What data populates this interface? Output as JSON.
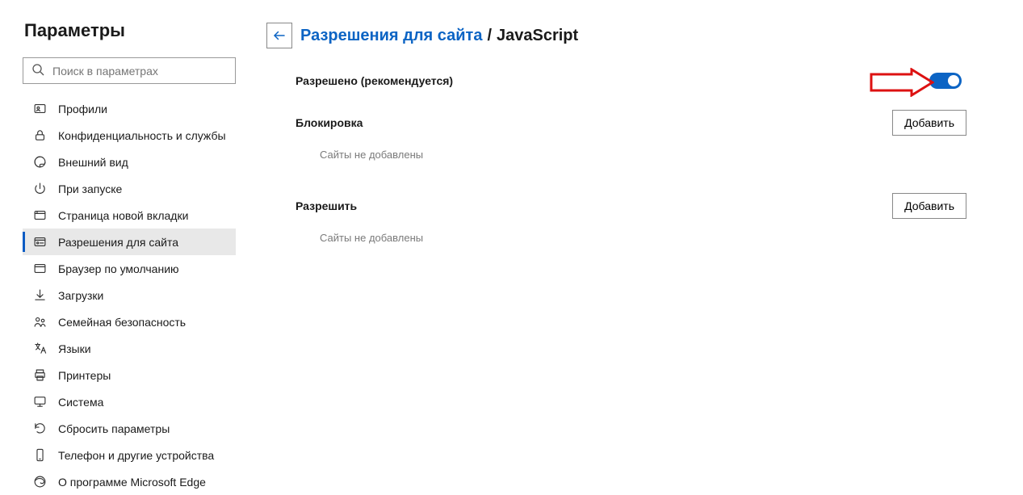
{
  "sidebar": {
    "title": "Параметры",
    "search_placeholder": "Поиск в параметрах",
    "items": [
      {
        "label": "Профили",
        "icon": "profile-card-icon"
      },
      {
        "label": "Конфиденциальность и службы",
        "icon": "lock-icon"
      },
      {
        "label": "Внешний вид",
        "icon": "appearance-icon"
      },
      {
        "label": "При запуске",
        "icon": "power-icon"
      },
      {
        "label": "Страница новой вкладки",
        "icon": "newtab-icon"
      },
      {
        "label": "Разрешения для сайта",
        "icon": "permissions-icon",
        "active": true
      },
      {
        "label": "Браузер по умолчанию",
        "icon": "browser-icon"
      },
      {
        "label": "Загрузки",
        "icon": "download-icon"
      },
      {
        "label": "Семейная безопасность",
        "icon": "family-icon"
      },
      {
        "label": "Языки",
        "icon": "language-icon"
      },
      {
        "label": "Принтеры",
        "icon": "printer-icon"
      },
      {
        "label": "Система",
        "icon": "system-icon"
      },
      {
        "label": "Сбросить параметры",
        "icon": "reset-icon"
      },
      {
        "label": "Телефон и другие устройства",
        "icon": "phone-icon"
      },
      {
        "label": "О программе Microsoft Edge",
        "icon": "edge-icon"
      }
    ]
  },
  "breadcrumb": {
    "parent": "Разрешения для сайта",
    "separator": "/",
    "current": "JavaScript"
  },
  "allowed": {
    "label": "Разрешено (рекомендуется)",
    "toggle_on": true
  },
  "block": {
    "title": "Блокировка",
    "add_label": "Добавить",
    "empty": "Сайты не добавлены"
  },
  "allow": {
    "title": "Разрешить",
    "add_label": "Добавить",
    "empty": "Сайты не добавлены"
  }
}
